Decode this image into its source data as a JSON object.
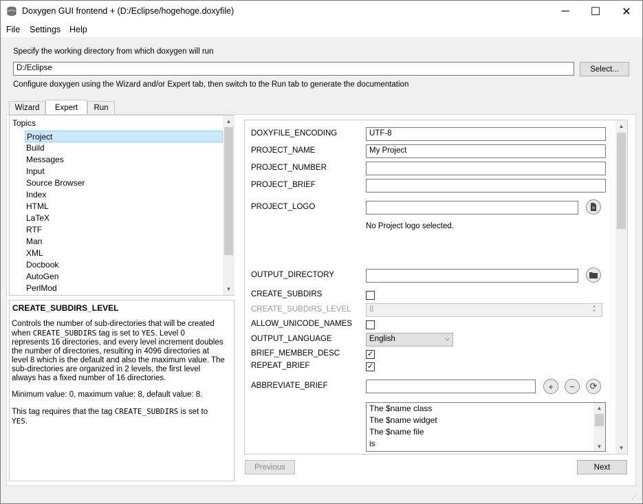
{
  "window": {
    "title": "Doxygen GUI frontend + (D:/Eclipse/hogehoge.doxyfile)",
    "minimize": "─",
    "maximize": "☐",
    "close": "✕"
  },
  "menu": [
    "File",
    "Settings",
    "Help"
  ],
  "workdir": {
    "label": "Specify the working directory from which doxygen will run",
    "value": "D:/Eclipse",
    "select_label": "Select..."
  },
  "configure_text": "Configure doxygen using the Wizard and/or Expert tab, then switch to the Run tab to generate the documentation",
  "tabs": [
    "Wizard",
    "Expert",
    "Run"
  ],
  "active_tab": "Expert",
  "topics": {
    "header": "Topics",
    "items": [
      "Project",
      "Build",
      "Messages",
      "Input",
      "Source Browser",
      "Index",
      "HTML",
      "LaTeX",
      "RTF",
      "Man",
      "XML",
      "Docbook",
      "AutoGen",
      "PerlMod"
    ],
    "selected": "Project"
  },
  "help": {
    "title": "CREATE_SUBDIRS_LEVEL",
    "p1_a": "Controls the number of sub-directories that will be created",
    "p1_b_pre": "when ",
    "p1_b_code": "CREATE_SUBDIRS",
    "p1_b_mid": " tag is set to ",
    "p1_b_code2": "YES",
    "p1_b_post": ". Level 0",
    "p1_c": "represents 16 directories, and every level increment doubles",
    "p1_d": "the number of directories, resulting in 4096 directories at",
    "p1_e": "level 8 which is the default and also the maximum value. The",
    "p1_f": "sub-directories are organized in 2 levels, the first level",
    "p1_g": "always has a fixed number of 16 directories.",
    "p2": "Minimum value: 0, maximum value: 8, default value: 8.",
    "p3_pre": "This tag requires that the tag ",
    "p3_code": "CREATE_SUBDIRS",
    "p3_post": " is set to",
    "p3_code2": "YES",
    "p3_end": "."
  },
  "options": {
    "doxyfile_encoding": {
      "label": "DOXYFILE_ENCODING",
      "value": "UTF-8"
    },
    "project_name": {
      "label": "PROJECT_NAME",
      "value": "My Project"
    },
    "project_number": {
      "label": "PROJECT_NUMBER",
      "value": ""
    },
    "project_brief": {
      "label": "PROJECT_BRIEF",
      "value": ""
    },
    "project_logo": {
      "label": "PROJECT_LOGO",
      "value": "",
      "note": "No Project logo selected."
    },
    "output_directory": {
      "label": "OUTPUT_DIRECTORY",
      "value": ""
    },
    "create_subdirs": {
      "label": "CREATE_SUBDIRS",
      "checked": false
    },
    "create_subdirs_level": {
      "label": "CREATE_SUBDIRS_LEVEL",
      "value": "8"
    },
    "allow_unicode_names": {
      "label": "ALLOW_UNICODE_NAMES",
      "checked": false
    },
    "output_language": {
      "label": "OUTPUT_LANGUAGE",
      "value": "English"
    },
    "brief_member_desc": {
      "label": "BRIEF_MEMBER_DESC",
      "checked": true
    },
    "repeat_brief": {
      "label": "REPEAT_BRIEF",
      "checked": true
    },
    "abbreviate_brief": {
      "label": "ABBREVIATE_BRIEF",
      "value": "",
      "list": [
        "The $name class",
        "The $name widget",
        "The $name file",
        "is"
      ]
    }
  },
  "nav": {
    "previous": "Previous",
    "next": "Next"
  },
  "check_mark": "✓"
}
